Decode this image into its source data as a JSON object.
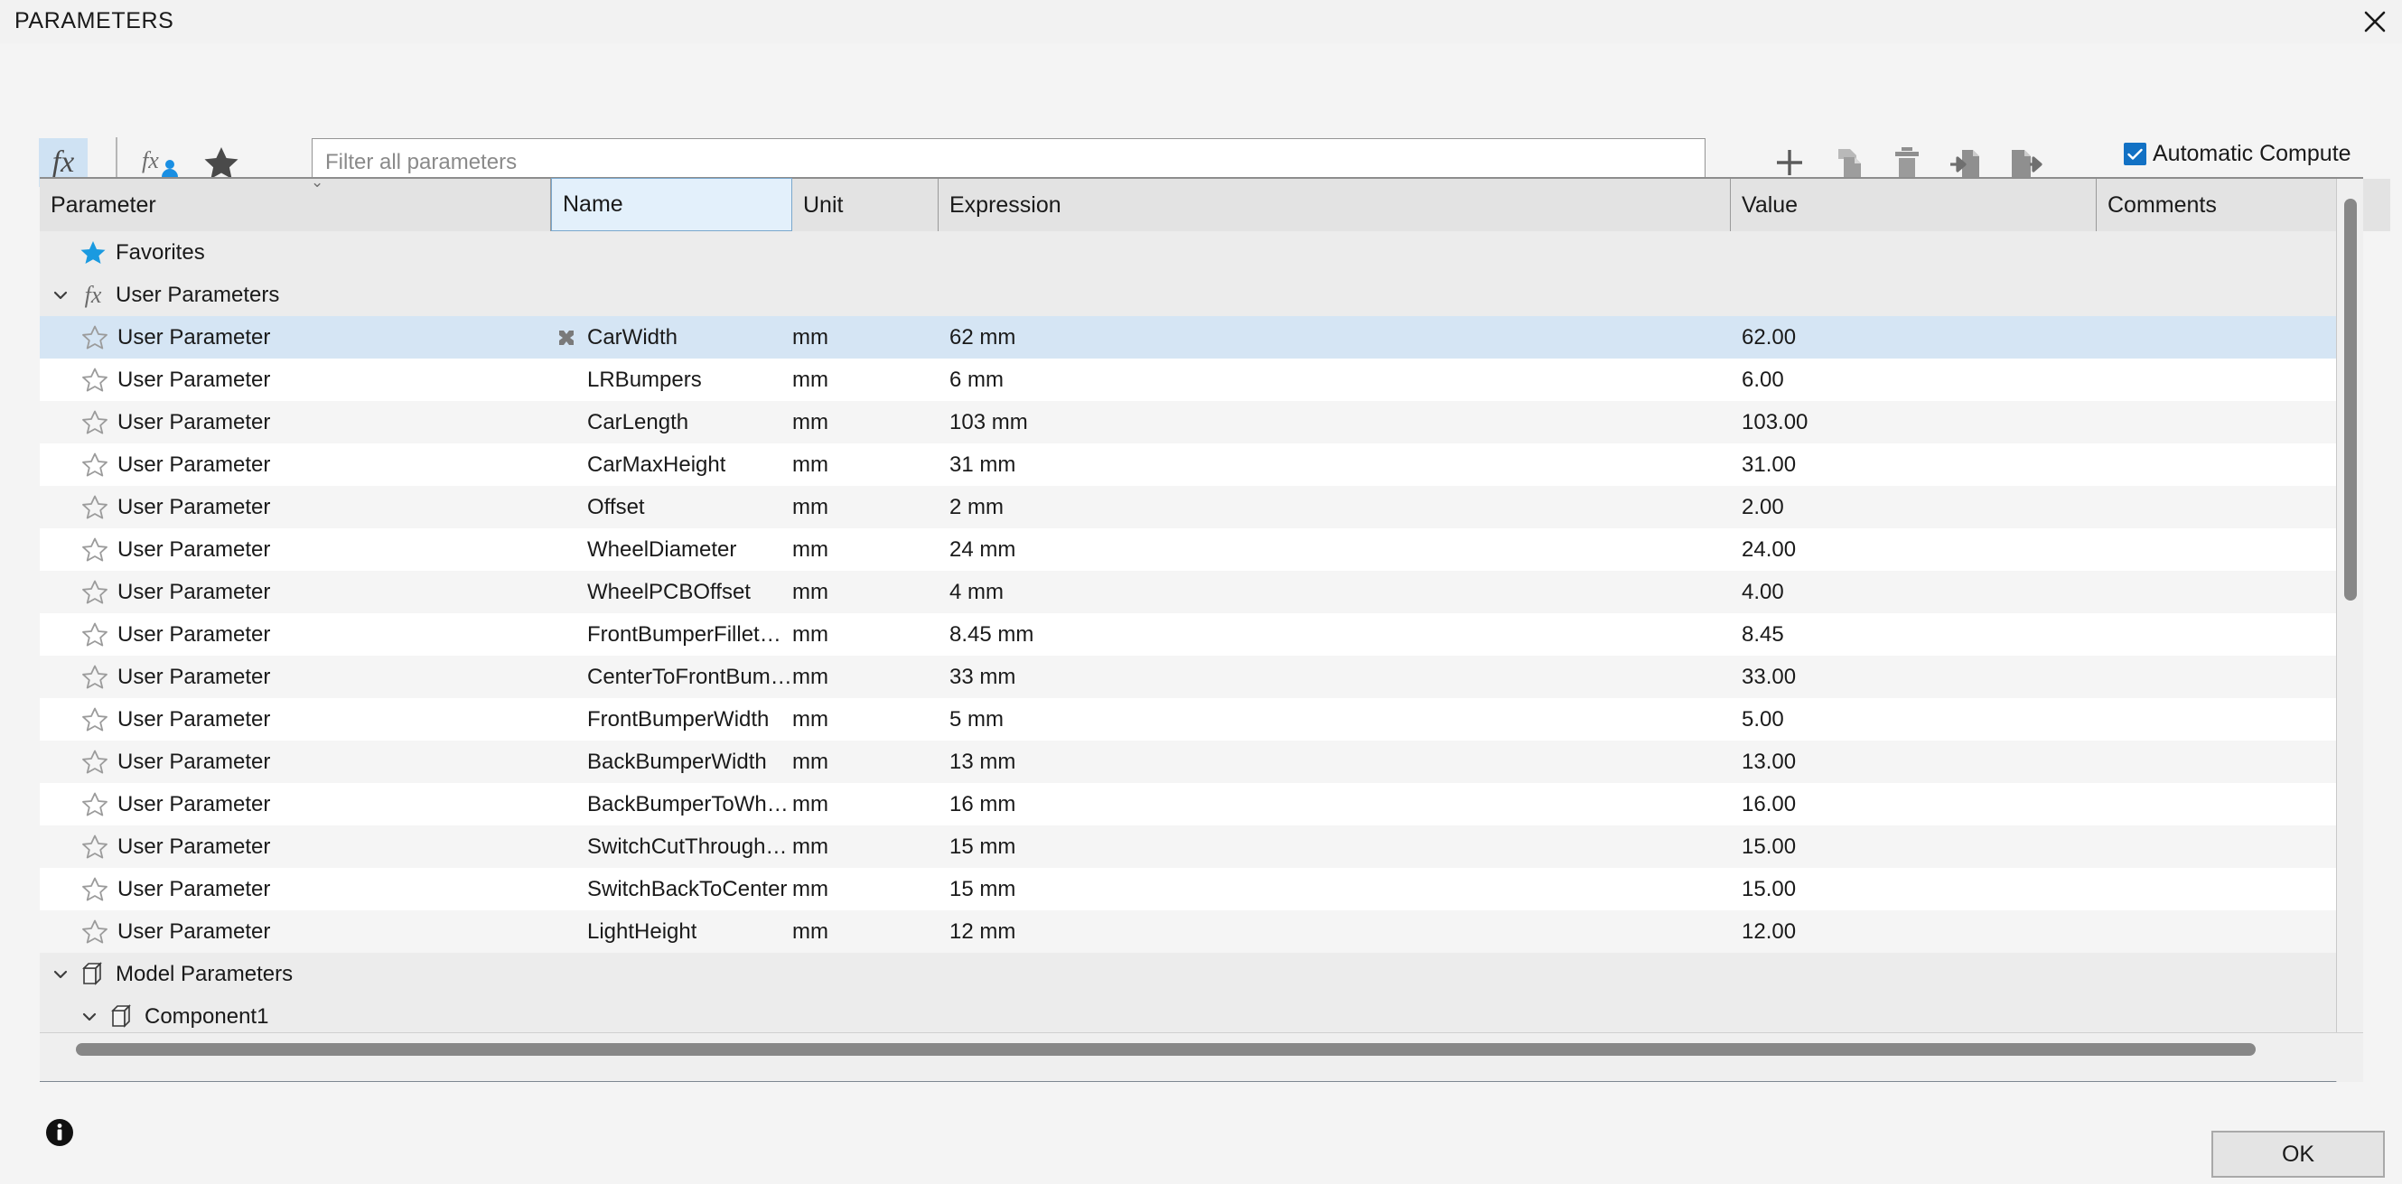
{
  "window": {
    "title": "PARAMETERS",
    "close_icon": "close-icon"
  },
  "toolbar": {
    "fx_all_label": "fx",
    "fx_all_icon": "fx-icon",
    "fx_user_icon": "fx-user-icon",
    "favorites_filter_icon": "star-filled-icon",
    "add_icon": "plus-icon",
    "duplicate_icon": "copy-icon",
    "delete_icon": "trash-icon",
    "import_icon": "import-icon",
    "export_icon": "export-icon",
    "automatic_compute_label": "Automatic Compute",
    "automatic_compute_checked": true,
    "accent_color": "#1271c4",
    "active_tool_bg": "#cfe2f3"
  },
  "search": {
    "placeholder": "Filter all parameters",
    "value": ""
  },
  "table": {
    "columns": [
      {
        "key": "parameter",
        "label": "Parameter",
        "sorted": false
      },
      {
        "key": "name",
        "label": "Name",
        "sorted": true
      },
      {
        "key": "unit",
        "label": "Unit",
        "sorted": false
      },
      {
        "key": "expression",
        "label": "Expression",
        "sorted": false
      },
      {
        "key": "value",
        "label": "Value",
        "sorted": false
      },
      {
        "key": "comments",
        "label": "Comments",
        "sorted": false
      }
    ],
    "sort_caret": "⌄",
    "groups": {
      "favorites": {
        "label": "Favorites",
        "icon": "star-filled-blue-icon",
        "expanded": false
      },
      "user_parameters": {
        "label": "User Parameters",
        "icon": "fx-icon",
        "expanded": true,
        "chevron": "⌄"
      },
      "model_parameters": {
        "label": "Model Parameters",
        "icon": "cube-icon",
        "expanded": true,
        "chevron": "⌄"
      },
      "component1": {
        "label": "Component1",
        "icon": "cube-icon",
        "expanded": true,
        "chevron": "⌄"
      }
    },
    "row_type_label": "User Parameter",
    "rows": [
      {
        "parameter": "User Parameter",
        "name": "CarWidth",
        "unit": "mm",
        "expression": "62 mm",
        "value": "62.00",
        "comments": "",
        "selected": true,
        "linked": true
      },
      {
        "parameter": "User Parameter",
        "name": "LRBumpers",
        "unit": "mm",
        "expression": "6 mm",
        "value": "6.00",
        "comments": "",
        "selected": false,
        "linked": false
      },
      {
        "parameter": "User Parameter",
        "name": "CarLength",
        "unit": "mm",
        "expression": "103 mm",
        "value": "103.00",
        "comments": "",
        "selected": false,
        "linked": false
      },
      {
        "parameter": "User Parameter",
        "name": "CarMaxHeight",
        "unit": "mm",
        "expression": "31 mm",
        "value": "31.00",
        "comments": "",
        "selected": false,
        "linked": false
      },
      {
        "parameter": "User Parameter",
        "name": "Offset",
        "unit": "mm",
        "expression": "2 mm",
        "value": "2.00",
        "comments": "",
        "selected": false,
        "linked": false
      },
      {
        "parameter": "User Parameter",
        "name": "WheelDiameter",
        "unit": "mm",
        "expression": "24 mm",
        "value": "24.00",
        "comments": "",
        "selected": false,
        "linked": false
      },
      {
        "parameter": "User Parameter",
        "name": "WheelPCBOffset",
        "unit": "mm",
        "expression": "4 mm",
        "value": "4.00",
        "comments": "",
        "selected": false,
        "linked": false
      },
      {
        "parameter": "User Parameter",
        "name": "FrontBumperFillet…",
        "unit": "mm",
        "expression": "8.45 mm",
        "value": "8.45",
        "comments": "",
        "selected": false,
        "linked": false
      },
      {
        "parameter": "User Parameter",
        "name": "CenterToFrontBum…",
        "unit": "mm",
        "expression": "33 mm",
        "value": "33.00",
        "comments": "",
        "selected": false,
        "linked": false
      },
      {
        "parameter": "User Parameter",
        "name": "FrontBumperWidth",
        "unit": "mm",
        "expression": "5 mm",
        "value": "5.00",
        "comments": "",
        "selected": false,
        "linked": false
      },
      {
        "parameter": "User Parameter",
        "name": "BackBumperWidth",
        "unit": "mm",
        "expression": "13 mm",
        "value": "13.00",
        "comments": "",
        "selected": false,
        "linked": false
      },
      {
        "parameter": "User Parameter",
        "name": "BackBumperToWh…",
        "unit": "mm",
        "expression": "16 mm",
        "value": "16.00",
        "comments": "",
        "selected": false,
        "linked": false
      },
      {
        "parameter": "User Parameter",
        "name": "SwitchCutThrough…",
        "unit": "mm",
        "expression": "15 mm",
        "value": "15.00",
        "comments": "",
        "selected": false,
        "linked": false
      },
      {
        "parameter": "User Parameter",
        "name": "SwitchBackToCenter",
        "unit": "mm",
        "expression": "15 mm",
        "value": "15.00",
        "comments": "",
        "selected": false,
        "linked": false
      },
      {
        "parameter": "User Parameter",
        "name": "LightHeight",
        "unit": "mm",
        "expression": "12 mm",
        "value": "12.00",
        "comments": "",
        "selected": false,
        "linked": false
      }
    ],
    "selection_color": "#d5e5f4"
  },
  "scrollbars": {
    "vertical_thumb": "vertical-scrollbar-thumb",
    "horizontal_thumb": "horizontal-scrollbar-thumb"
  },
  "footer": {
    "info_icon": "info-icon",
    "ok_label": "OK"
  }
}
